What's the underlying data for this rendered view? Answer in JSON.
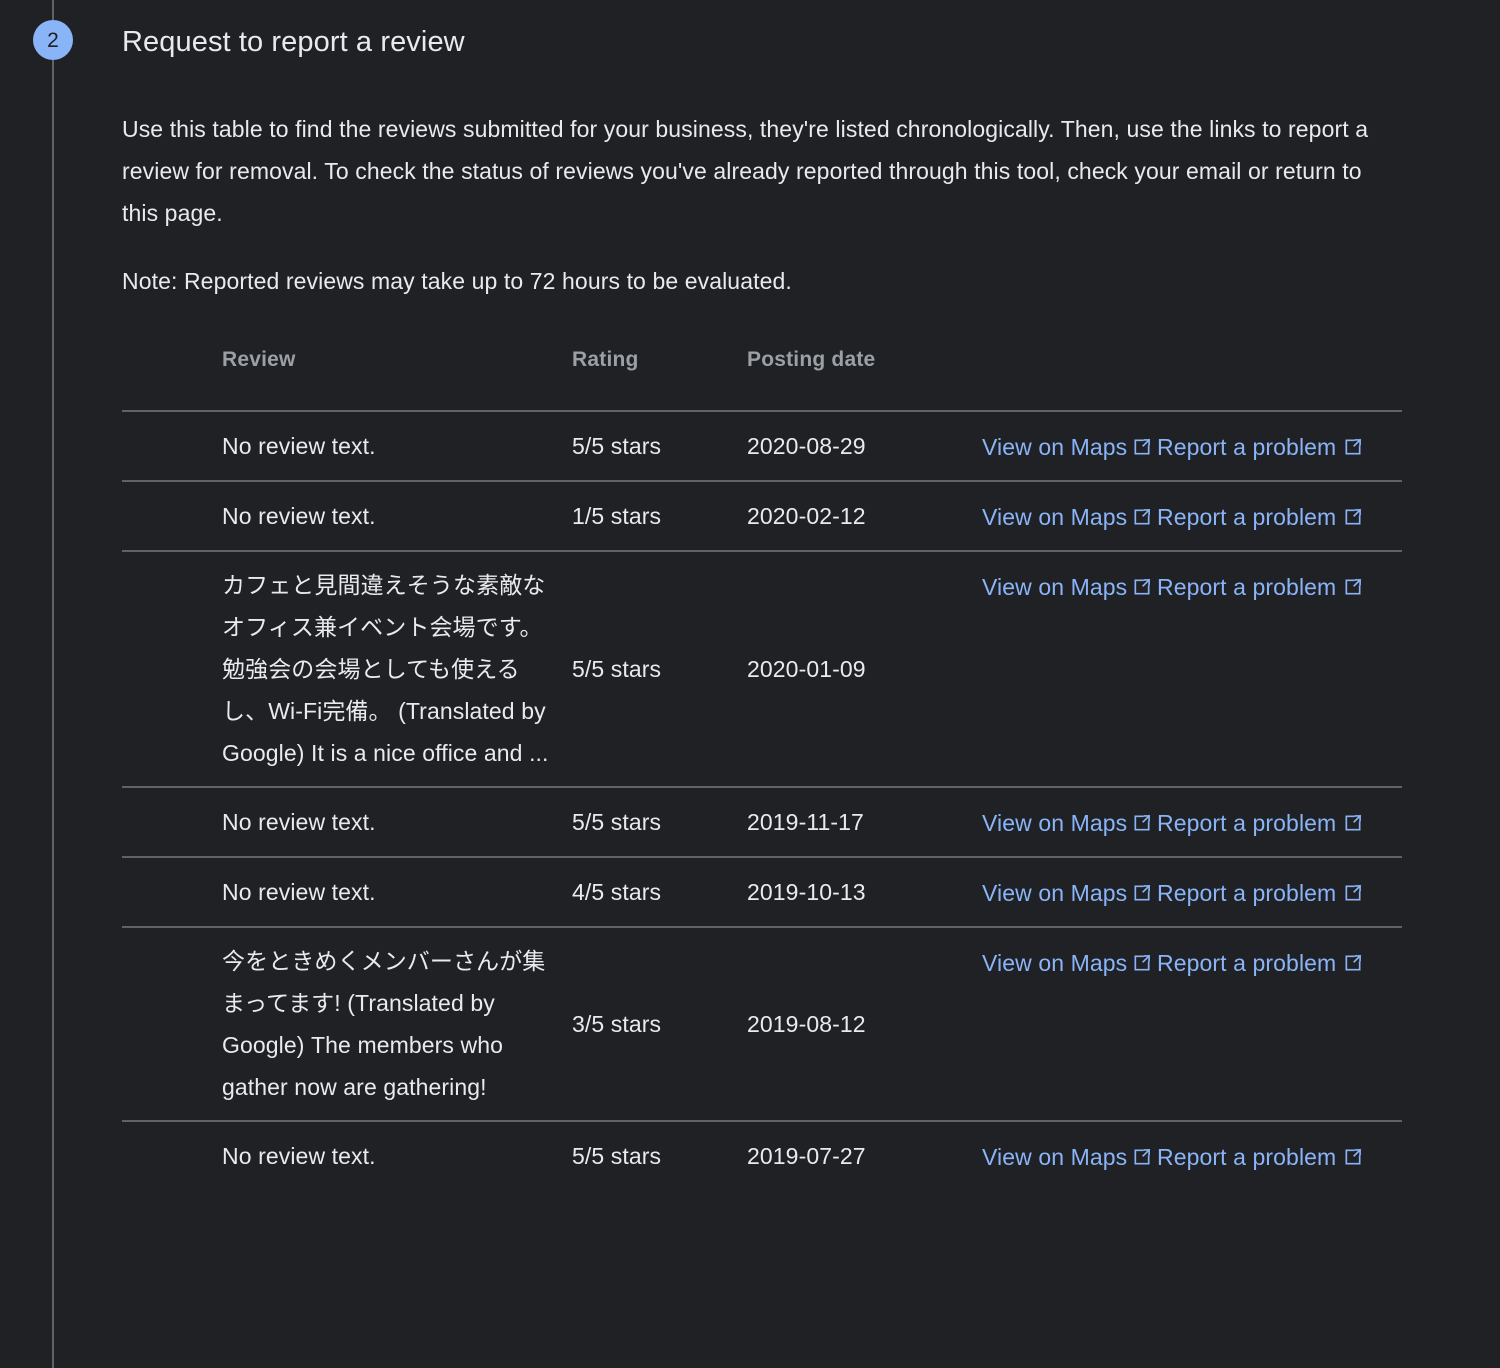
{
  "step": {
    "number": "2",
    "title": "Request to report a review"
  },
  "body": {
    "intro": "Use this table to find the reviews submitted for your business, they're listed chronologically. Then, use the links to report a review for removal. To check the status of reviews you've already reported through this tool, check your email or return to this page.",
    "note": "Note: Reported reviews may take up to 72 hours to be evaluated."
  },
  "table": {
    "columns": [
      "Review",
      "Rating",
      "Posting date",
      "",
      ""
    ],
    "links": {
      "maps_label": "View on Maps",
      "report_label": "Report a problem",
      "maps_icon": "external-link-icon",
      "report_icon": "external-link-icon"
    },
    "rows": [
      {
        "review": "No review text.",
        "rating": "5/5 stars",
        "date": "2020-08-29",
        "maps": "View on Maps",
        "report": "Report a problem"
      },
      {
        "review": "No review text.",
        "rating": "1/5 stars",
        "date": "2020-02-12",
        "maps": "View on Maps",
        "report": "Report a problem"
      },
      {
        "review": "カフェと見間違えそうな素敵なオフィス兼イベント会場です。勉強会の会場としても使えるし、Wi-Fi完備。 (Translated by Google) It is a nice office and ...",
        "rating": "5/5 stars",
        "date": "2020-01-09",
        "maps": "View on Maps",
        "report": "Report a problem"
      },
      {
        "review": "No review text.",
        "rating": "5/5 stars",
        "date": "2019-11-17",
        "maps": "View on Maps",
        "report": "Report a problem"
      },
      {
        "review": "No review text.",
        "rating": "4/5 stars",
        "date": "2019-10-13",
        "maps": "View on Maps",
        "report": "Report a problem"
      },
      {
        "review": "今をときめくメンバーさんが集まってます! (Translated by Google) The members who gather now are gathering!",
        "rating": "3/5 stars",
        "date": "2019-08-12",
        "maps": "View on Maps",
        "report": "Report a problem"
      },
      {
        "review": "No review text.",
        "rating": "5/5 stars",
        "date": "2019-07-27",
        "maps": "View on Maps",
        "report": "Report a problem"
      }
    ]
  },
  "colors": {
    "background": "#202124",
    "text": "#e8eaed",
    "muted": "#9aa0a6",
    "divider": "#5f6368",
    "accent": "#8ab4f8"
  }
}
